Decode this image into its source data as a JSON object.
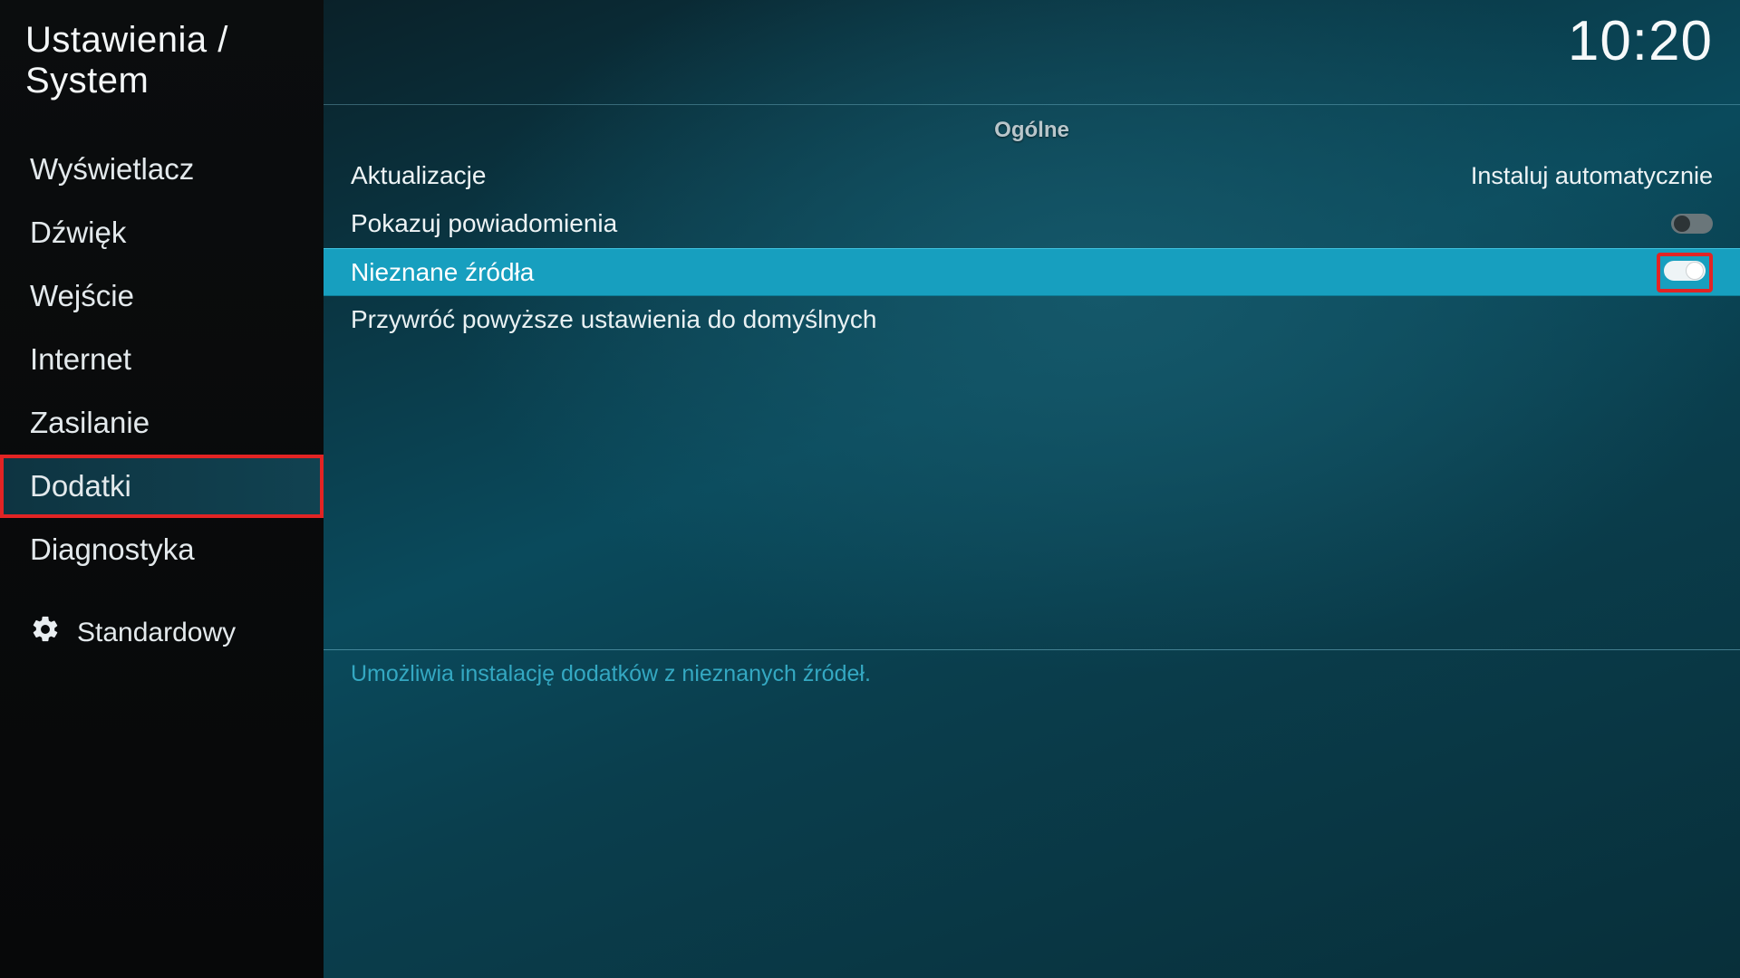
{
  "header": {
    "title": "Ustawienia / System",
    "clock": "10:20"
  },
  "sidebar": {
    "items": [
      {
        "label": "Wyświetlacz",
        "selected": false
      },
      {
        "label": "Dźwięk",
        "selected": false
      },
      {
        "label": "Wejście",
        "selected": false
      },
      {
        "label": "Internet",
        "selected": false
      },
      {
        "label": "Zasilanie",
        "selected": false
      },
      {
        "label": "Dodatki",
        "selected": true
      },
      {
        "label": "Diagnostyka",
        "selected": false
      }
    ],
    "level_label": "Standardowy"
  },
  "main": {
    "section_header": "Ogólne",
    "rows": {
      "updates": {
        "label": "Aktualizacje",
        "value": "Instaluj automatycznie"
      },
      "notifications": {
        "label": "Pokazuj powiadomienia",
        "toggle": "off"
      },
      "unknown": {
        "label": "Nieznane źródła",
        "toggle": "on",
        "highlighted": true,
        "marked": true
      },
      "reset": {
        "label": "Przywróć powyższe ustawienia do domyślnych"
      }
    },
    "description": "Umożliwia instalację dodatków z nieznanych źródeł."
  }
}
